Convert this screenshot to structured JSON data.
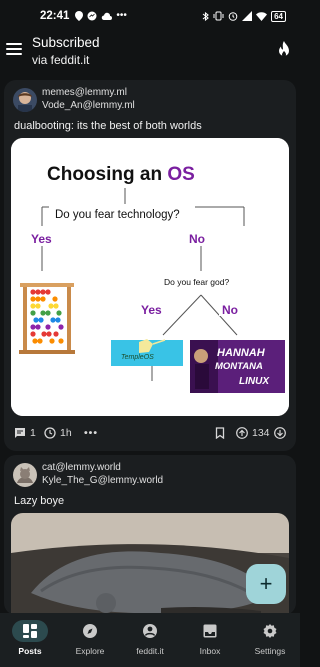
{
  "status": {
    "time": "22:41",
    "battery": "64"
  },
  "appbar": {
    "title": "Subscribed",
    "subtitle": "via feddit.it"
  },
  "posts": [
    {
      "community": "memes@lemmy.ml",
      "author": "Vode_An@lemmy.ml",
      "title": "dualbooting: its the best of both worlds",
      "image": {
        "heading_part1": "Choosing an ",
        "heading_part2": "OS",
        "q1": "Do you fear technology?",
        "yes1": "Yes",
        "no1": "No",
        "q2": "Do you fear god?",
        "yes2": "Yes",
        "no2": "No",
        "templeos_text": "TempleOS",
        "hm_line1": "HANNAH",
        "hm_line2": "MONTANA",
        "hm_line3": "LINUX"
      },
      "comments": "1",
      "age": "1h",
      "score": "134"
    },
    {
      "community": "cat@lemmy.world",
      "author": "Kyle_The_G@lemmy.world",
      "title": "Lazy boye"
    }
  ],
  "fab_label": "+",
  "nav": [
    {
      "label": "Posts",
      "icon": "posts-icon",
      "active": true
    },
    {
      "label": "Explore",
      "icon": "compass-icon",
      "active": false
    },
    {
      "label": "feddit.it",
      "icon": "account-icon",
      "active": false
    },
    {
      "label": "Inbox",
      "icon": "inbox-icon",
      "active": false
    },
    {
      "label": "Settings",
      "icon": "gear-icon",
      "active": false
    }
  ],
  "colors": {
    "background": "#111314",
    "card": "#1b1e20",
    "accent": "#9fd4d9",
    "chart_purple": "#7a1fa0",
    "os_purple": "#8a2be2"
  }
}
